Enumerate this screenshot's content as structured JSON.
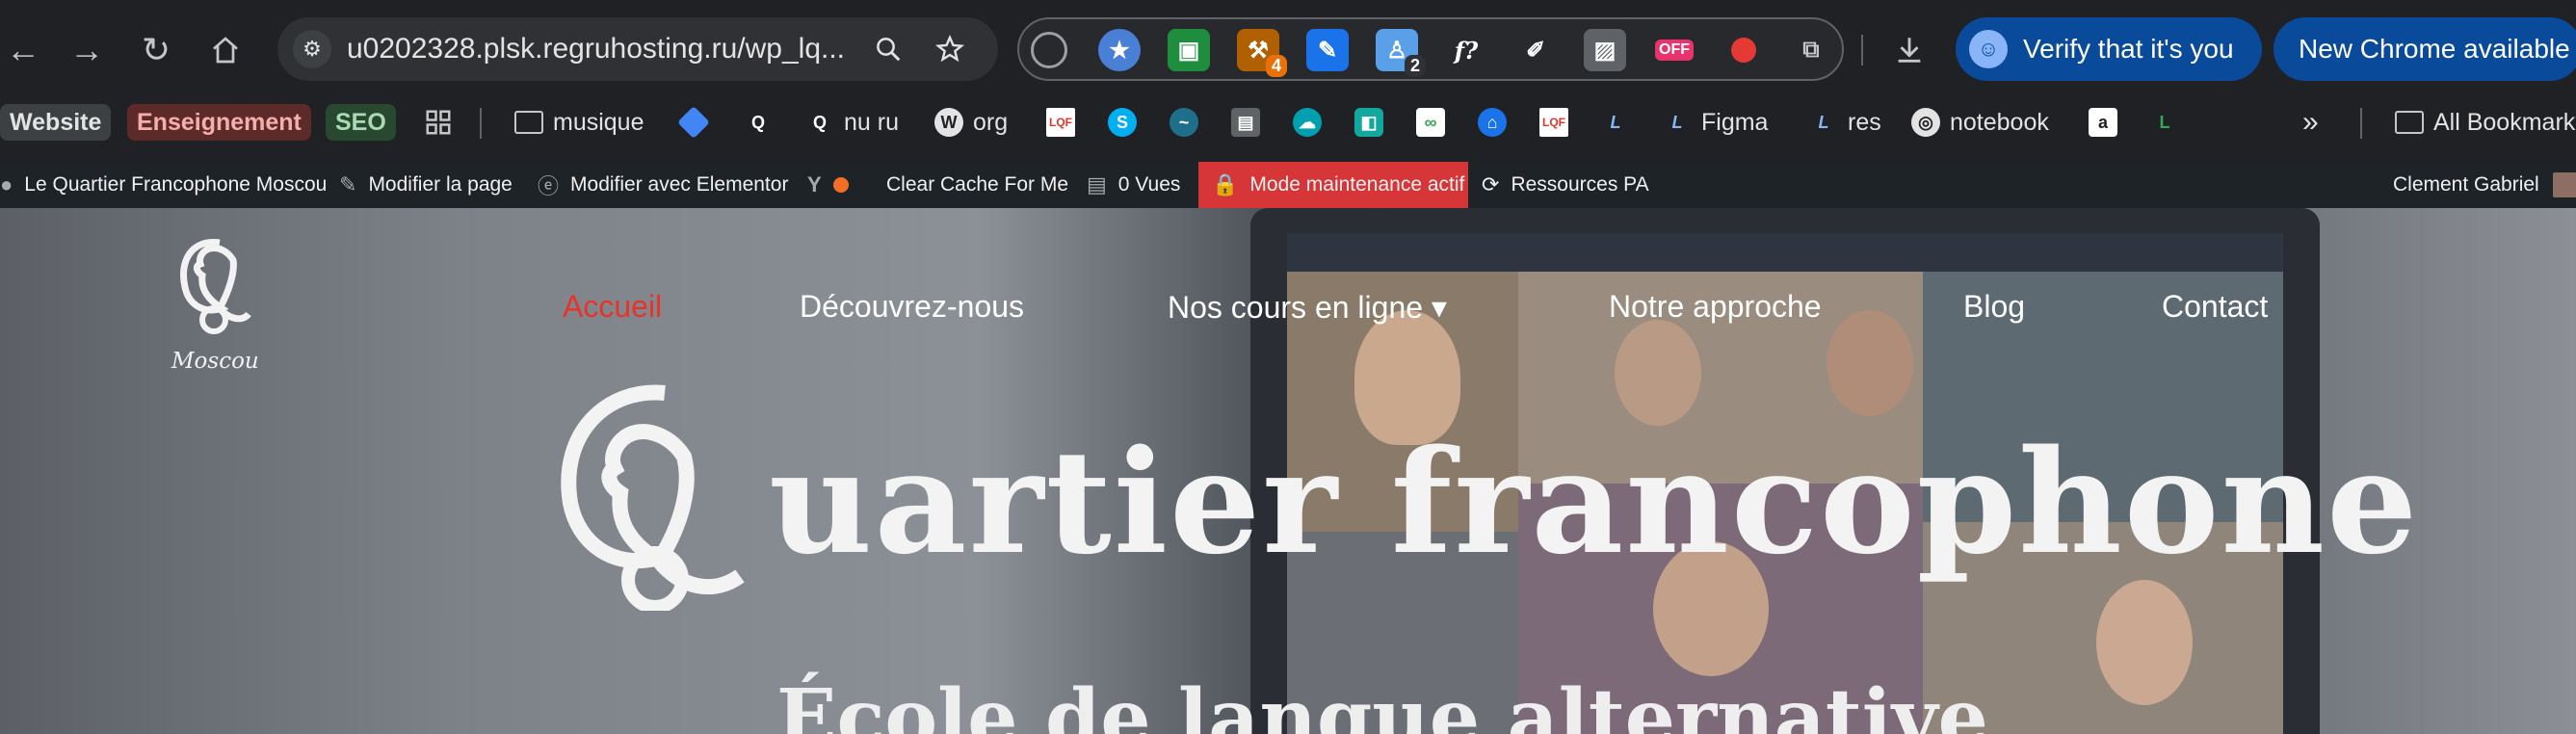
{
  "browser": {
    "url": "u0202328.plsk.regruhosting.ru/wp_lq...",
    "verify_label": "Verify that it's you",
    "new_chrome_label": "New Chrome available",
    "ext_badges": {
      "ext3": "4",
      "ext5": "2",
      "ext9": "OFF"
    }
  },
  "bookmarks": {
    "website": "Website",
    "enseignement": "Enseignement",
    "seo": "SEO",
    "musique": "musique",
    "nu_ru": "nu ru",
    "org": "org",
    "figma": "Figma",
    "res": "res",
    "notebook": "notebook",
    "all_bookmarks": "All Bookmarks"
  },
  "adminbar": {
    "site_name": "Le Quartier Francophone Moscou",
    "edit_page": "Modifier la page",
    "elementor": "Modifier avec Elementor",
    "clear_cache": "Clear Cache For Me",
    "views": "0 Vues",
    "maintenance": "Mode maintenance actif",
    "resources": "Ressources PA",
    "user": "Clement Gabriel"
  },
  "site": {
    "logo_tag": "Moscou",
    "menu": {
      "home": "Accueil",
      "discover": "Découvrez-nous",
      "courses": "Nos cours en ligne ▾",
      "approach": "Notre approche",
      "blog": "Blog",
      "contact": "Contact"
    },
    "brand_word": "uartier francophone",
    "tagline": "École de langue alternative"
  },
  "colors": {
    "active_menu": "#e8332a",
    "maintenance": "#d63638",
    "adminbar": "#1d2327",
    "chrome_bg": "#202124"
  }
}
